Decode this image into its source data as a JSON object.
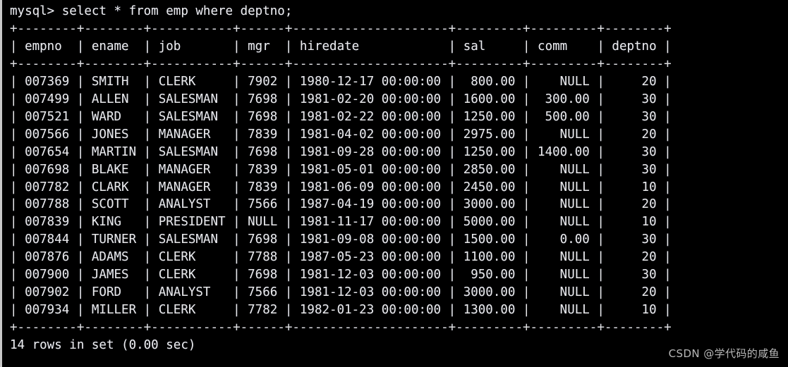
{
  "terminal": {
    "prompt": "mysql> ",
    "command": "select * from emp where deptno;",
    "prompt_line": "mysql> select * from emp where deptno;",
    "status_line": "14 rows in set (0.00 sec)",
    "row_count": 14,
    "elapsed": "0.00 sec",
    "background_color": "#000000",
    "text_color": "#e6e6e6",
    "watermark": "CSDN @学代码的咸鱼"
  },
  "result_table": {
    "separator": "+--------+--------+-----------+------+---------------------+---------+---------+--------+",
    "columns": [
      {
        "name": "empno",
        "width": 6,
        "align": "right"
      },
      {
        "name": "ename",
        "width": 6,
        "align": "left"
      },
      {
        "name": "job",
        "width": 9,
        "align": "left"
      },
      {
        "name": "mgr",
        "width": 4,
        "align": "right"
      },
      {
        "name": "hiredate",
        "width": 19,
        "align": "left"
      },
      {
        "name": "sal",
        "width": 7,
        "align": "right"
      },
      {
        "name": "comm",
        "width": 7,
        "align": "right"
      },
      {
        "name": "deptno",
        "width": 6,
        "align": "right"
      }
    ],
    "rows": [
      {
        "empno": "007369",
        "ename": "SMITH",
        "job": "CLERK",
        "mgr": "7902",
        "hiredate": "1980-12-17 00:00:00",
        "sal": "800.00",
        "comm": "NULL",
        "deptno": "20"
      },
      {
        "empno": "007499",
        "ename": "ALLEN",
        "job": "SALESMAN",
        "mgr": "7698",
        "hiredate": "1981-02-20 00:00:00",
        "sal": "1600.00",
        "comm": "300.00",
        "deptno": "30"
      },
      {
        "empno": "007521",
        "ename": "WARD",
        "job": "SALESMAN",
        "mgr": "7698",
        "hiredate": "1981-02-22 00:00:00",
        "sal": "1250.00",
        "comm": "500.00",
        "deptno": "30"
      },
      {
        "empno": "007566",
        "ename": "JONES",
        "job": "MANAGER",
        "mgr": "7839",
        "hiredate": "1981-04-02 00:00:00",
        "sal": "2975.00",
        "comm": "NULL",
        "deptno": "20"
      },
      {
        "empno": "007654",
        "ename": "MARTIN",
        "job": "SALESMAN",
        "mgr": "7698",
        "hiredate": "1981-09-28 00:00:00",
        "sal": "1250.00",
        "comm": "1400.00",
        "deptno": "30"
      },
      {
        "empno": "007698",
        "ename": "BLAKE",
        "job": "MANAGER",
        "mgr": "7839",
        "hiredate": "1981-05-01 00:00:00",
        "sal": "2850.00",
        "comm": "NULL",
        "deptno": "30"
      },
      {
        "empno": "007782",
        "ename": "CLARK",
        "job": "MANAGER",
        "mgr": "7839",
        "hiredate": "1981-06-09 00:00:00",
        "sal": "2450.00",
        "comm": "NULL",
        "deptno": "10"
      },
      {
        "empno": "007788",
        "ename": "SCOTT",
        "job": "ANALYST",
        "mgr": "7566",
        "hiredate": "1987-04-19 00:00:00",
        "sal": "3000.00",
        "comm": "NULL",
        "deptno": "20"
      },
      {
        "empno": "007839",
        "ename": "KING",
        "job": "PRESIDENT",
        "mgr": "NULL",
        "hiredate": "1981-11-17 00:00:00",
        "sal": "5000.00",
        "comm": "NULL",
        "deptno": "10"
      },
      {
        "empno": "007844",
        "ename": "TURNER",
        "job": "SALESMAN",
        "mgr": "7698",
        "hiredate": "1981-09-08 00:00:00",
        "sal": "1500.00",
        "comm": "0.00",
        "deptno": "30"
      },
      {
        "empno": "007876",
        "ename": "ADAMS",
        "job": "CLERK",
        "mgr": "7788",
        "hiredate": "1987-05-23 00:00:00",
        "sal": "1100.00",
        "comm": "NULL",
        "deptno": "20"
      },
      {
        "empno": "007900",
        "ename": "JAMES",
        "job": "CLERK",
        "mgr": "7698",
        "hiredate": "1981-12-03 00:00:00",
        "sal": "950.00",
        "comm": "NULL",
        "deptno": "30"
      },
      {
        "empno": "007902",
        "ename": "FORD",
        "job": "ANALYST",
        "mgr": "7566",
        "hiredate": "1981-12-03 00:00:00",
        "sal": "3000.00",
        "comm": "NULL",
        "deptno": "20"
      },
      {
        "empno": "007934",
        "ename": "MILLER",
        "job": "CLERK",
        "mgr": "7782",
        "hiredate": "1982-01-23 00:00:00",
        "sal": "1300.00",
        "comm": "NULL",
        "deptno": "10"
      }
    ]
  }
}
